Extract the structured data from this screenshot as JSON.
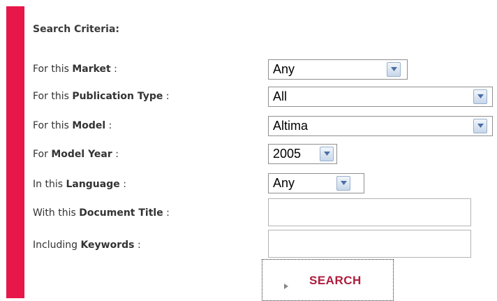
{
  "colors": {
    "accent": "#e8174a",
    "search_text": "#b01c3d"
  },
  "form": {
    "heading": "Search Criteria:",
    "market": {
      "prefix": "For this ",
      "bold": "Market",
      "suffix": " :",
      "value": "Any"
    },
    "publication_type": {
      "prefix": "For this ",
      "bold": "Publication Type",
      "suffix": " :",
      "value": "All"
    },
    "model": {
      "prefix": "For this ",
      "bold": "Model",
      "suffix": " :",
      "value": "Altima"
    },
    "model_year": {
      "prefix": "For ",
      "bold": "Model Year",
      "suffix": " :",
      "value": "2005"
    },
    "language": {
      "prefix": "In this ",
      "bold": "Language",
      "suffix": " :",
      "value": "Any"
    },
    "document_title": {
      "prefix": "With this ",
      "bold": "Document Title",
      "suffix": " :",
      "value": ""
    },
    "keywords": {
      "prefix": "Including ",
      "bold": "Keywords",
      "suffix": " :",
      "value": ""
    },
    "search_label": "SEARCH"
  },
  "icons": {
    "dropdown": "chevron-down-icon",
    "search_arrow": "triangle-right-icon"
  }
}
